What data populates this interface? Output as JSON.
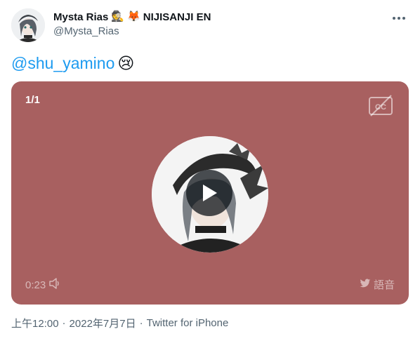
{
  "author": {
    "display_name": "Mysta Rias",
    "emojis": [
      "🕵️",
      "🦊"
    ],
    "affiliation": "NIJISANJI EN",
    "handle": "@Mysta_Rias"
  },
  "tweet": {
    "mention": "@shu_yamino",
    "emoji": "😢"
  },
  "media": {
    "counter": "1/1",
    "time": "0:23",
    "audio_label": "語音",
    "background_color": "#a86060"
  },
  "meta": {
    "time": "上午12:00",
    "date": "2022年7月7日",
    "source": "Twitter for iPhone",
    "separator": "·"
  },
  "icons": {
    "more": "more-icon",
    "cc": "closed-captions-icon",
    "play": "play-icon",
    "volume": "volume-icon",
    "twitter": "twitter-bird-icon"
  }
}
